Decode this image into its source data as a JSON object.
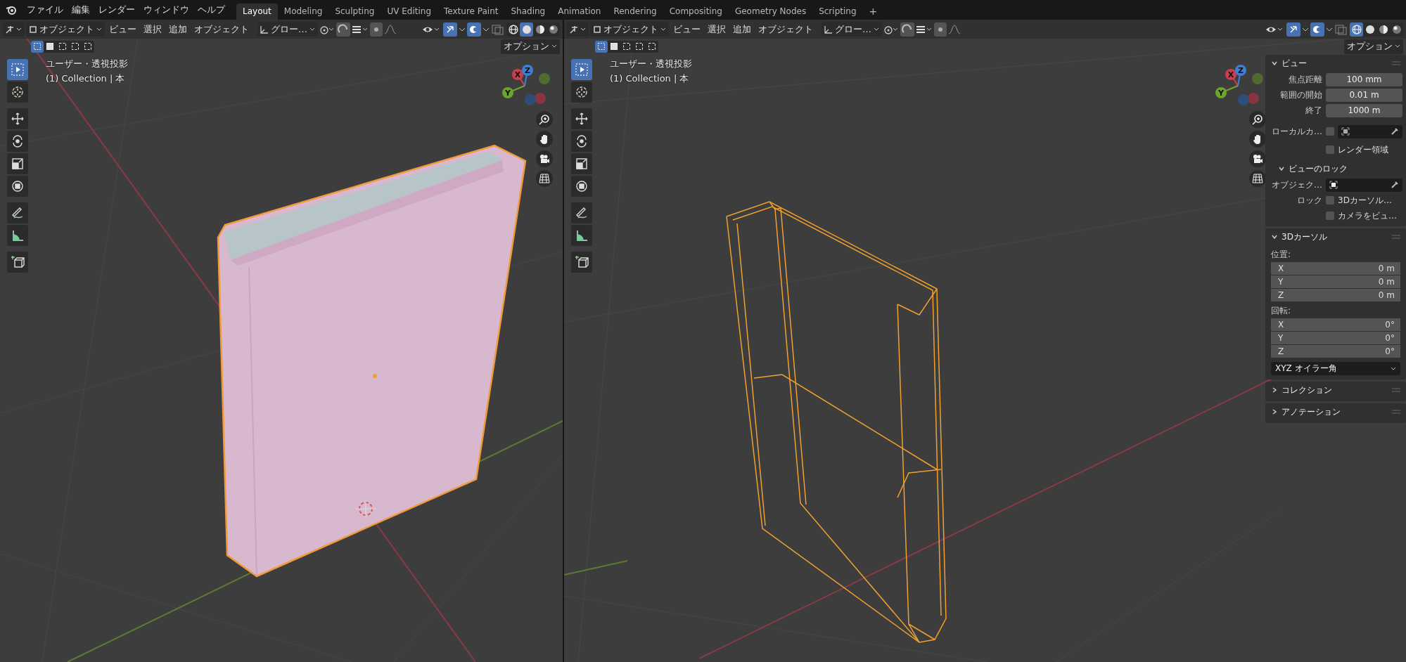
{
  "topbar": {
    "menus": [
      "ファイル",
      "編集",
      "レンダー",
      "ウィンドウ",
      "ヘルプ"
    ],
    "workspaces": [
      {
        "label": "Layout",
        "selected": true
      },
      {
        "label": "Modeling",
        "selected": false
      },
      {
        "label": "Sculpting",
        "selected": false
      },
      {
        "label": "UV Editing",
        "selected": false
      },
      {
        "label": "Texture Paint",
        "selected": false
      },
      {
        "label": "Shading",
        "selected": false
      },
      {
        "label": "Animation",
        "selected": false
      },
      {
        "label": "Rendering",
        "selected": false
      },
      {
        "label": "Compositing",
        "selected": false
      },
      {
        "label": "Geometry Nodes",
        "selected": false
      },
      {
        "label": "Scripting",
        "selected": false
      }
    ],
    "add_tab": "+"
  },
  "viewports": [
    {
      "kind": "solid",
      "mode": "オブジェクト",
      "menus": [
        "ビュー",
        "選択",
        "追加",
        "オブジェクト"
      ],
      "orientation": "グロー…",
      "shading": [
        {
          "selected": false
        },
        {
          "selected": true
        },
        {
          "selected": false
        },
        {
          "selected": false
        }
      ],
      "select_modes": [
        {
          "selected": true
        },
        {
          "selected": false
        },
        {
          "selected": false
        },
        {
          "selected": false
        },
        {
          "selected": false
        }
      ],
      "options": "オプション",
      "view_name": "ユーザー・透視投影",
      "collection": "(1) Collection | 本",
      "tools": [
        {
          "selected": true
        },
        {
          "selected": false
        },
        {
          "selected": false
        },
        {
          "selected": false
        },
        {
          "selected": false
        },
        {
          "selected": false
        },
        {
          "selected": false
        },
        {
          "selected": false
        },
        {
          "selected": false
        }
      ],
      "gizmo": [
        {
          "label": "X",
          "color": "#c8404f"
        },
        {
          "label": "Z",
          "color": "#3d7fd6"
        },
        {
          "label": "Y",
          "color": "#6ba42b"
        },
        {
          "color": "#4f6b30"
        },
        {
          "color": "#8a3440"
        },
        {
          "color": "#2f4d7a"
        }
      ]
    },
    {
      "kind": "wireframe",
      "mode": "オブジェクト",
      "menus": [
        "ビュー",
        "選択",
        "追加",
        "オブジェクト"
      ],
      "orientation": "グロー…",
      "shading": [
        {
          "selected": true
        },
        {
          "selected": false
        },
        {
          "selected": false
        },
        {
          "selected": false
        }
      ],
      "select_modes": [
        {
          "selected": true
        },
        {
          "selected": false
        },
        {
          "selected": false
        },
        {
          "selected": false
        },
        {
          "selected": false
        }
      ],
      "options": "オプション",
      "view_name": "ユーザー・透視投影",
      "collection": "(1) Collection | 本",
      "tools": [
        {
          "selected": true
        },
        {
          "selected": false
        },
        {
          "selected": false
        },
        {
          "selected": false
        },
        {
          "selected": false
        },
        {
          "selected": false
        },
        {
          "selected": false
        },
        {
          "selected": false
        },
        {
          "selected": false
        }
      ],
      "gizmo": [
        {
          "label": "X",
          "color": "#c8404f"
        },
        {
          "label": "Z",
          "color": "#3d7fd6"
        },
        {
          "label": "Y",
          "color": "#6ba42b"
        },
        {
          "color": "#4f6b30"
        },
        {
          "color": "#8a3440"
        },
        {
          "color": "#2f4d7a"
        }
      ],
      "sidebar": {
        "view_panel": {
          "title": "ビュー",
          "expanded": true,
          "fields": [
            {
              "label": "焦点距離",
              "value": "100 mm"
            },
            {
              "label": "範囲の開始",
              "value": "0.01 m"
            },
            {
              "label": "終了",
              "value": "1000 m"
            }
          ],
          "local_camera": {
            "label": "ローカルカ…",
            "checked": false
          },
          "render_region": {
            "label": "レンダー領域",
            "checked": false
          },
          "lock": {
            "title": "ビューのロック",
            "expanded": true,
            "object_label": "オブジェク…",
            "lock_label": "ロック",
            "options": [
              {
                "label": "3Dカーソル…",
                "checked": false
              },
              {
                "label": "カメラをビュ…",
                "checked": false
              }
            ]
          }
        },
        "cursor_panel": {
          "title": "3Dカーソル",
          "expanded": true,
          "location_label": "位置:",
          "location": [
            {
              "axis": "X",
              "value": "0 m"
            },
            {
              "axis": "Y",
              "value": "0 m"
            },
            {
              "axis": "Z",
              "value": "0 m"
            }
          ],
          "rotation_label": "回転:",
          "rotation": [
            {
              "axis": "X",
              "value": "0°"
            },
            {
              "axis": "Y",
              "value": "0°"
            },
            {
              "axis": "Z",
              "value": "0°"
            }
          ],
          "rotation_mode": "XYZ オイラー角"
        },
        "collapsed_panels": [
          {
            "title": "コレクション",
            "expanded": false
          },
          {
            "title": "アノテーション",
            "expanded": false
          }
        ]
      }
    }
  ]
}
